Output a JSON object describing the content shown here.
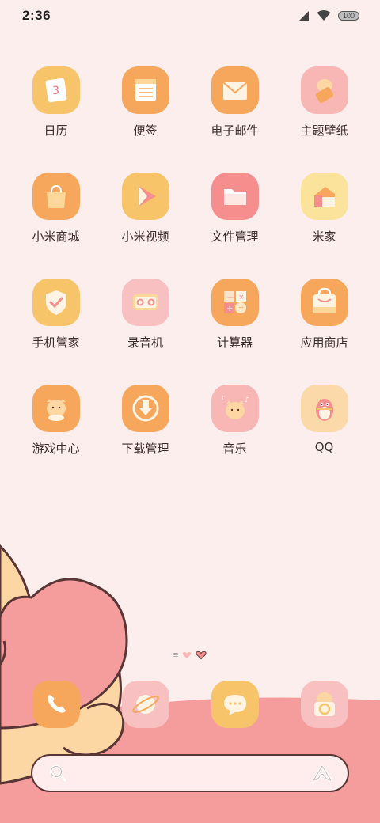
{
  "status_bar": {
    "time": "2:36",
    "battery": "100",
    "signal_icon": "cellular-signal-icon",
    "wifi_icon": "wifi-icon"
  },
  "apps": [
    {
      "label": "日历",
      "icon": "calendar-icon",
      "bg": "#f8c46a"
    },
    {
      "label": "便签",
      "icon": "notes-icon",
      "bg": "#f7a75c"
    },
    {
      "label": "电子邮件",
      "icon": "email-icon",
      "bg": "#f7a75c"
    },
    {
      "label": "主题壁纸",
      "icon": "themes-icon",
      "bg": "#f8b7b5"
    },
    {
      "label": "小米商城",
      "icon": "mi-store-icon",
      "bg": "#f7a75c"
    },
    {
      "label": "小米视频",
      "icon": "video-play-icon",
      "bg": "#f8c46a"
    },
    {
      "label": "文件管理",
      "icon": "folder-icon",
      "bg": "#f68e8e"
    },
    {
      "label": "米家",
      "icon": "home-icon",
      "bg": "#fbe39c"
    },
    {
      "label": "手机管家",
      "icon": "shield-icon",
      "bg": "#f8c46a"
    },
    {
      "label": "录音机",
      "icon": "recorder-icon",
      "bg": "#f8c0c0"
    },
    {
      "label": "计算器",
      "icon": "calculator-icon",
      "bg": "#f7a75c"
    },
    {
      "label": "应用商店",
      "icon": "app-store-icon",
      "bg": "#f7a75c"
    },
    {
      "label": "游戏中心",
      "icon": "game-center-icon",
      "bg": "#f7a75c"
    },
    {
      "label": "下载管理",
      "icon": "download-icon",
      "bg": "#f7a75c"
    },
    {
      "label": "音乐",
      "icon": "music-icon",
      "bg": "#f8b7b5"
    },
    {
      "label": "QQ",
      "icon": "qq-penguin-icon",
      "bg": "#fbd9a8"
    }
  ],
  "dock": [
    {
      "icon": "phone-icon",
      "bg": "#f7a75c"
    },
    {
      "icon": "browser-icon",
      "bg": "#f8c0c0"
    },
    {
      "icon": "messages-icon",
      "bg": "#f8c46a"
    },
    {
      "icon": "camera-icon",
      "bg": "#f8c0c0"
    }
  ],
  "search": {
    "search_icon": "search-icon",
    "assistant_icon": "voice-assistant-icon"
  }
}
